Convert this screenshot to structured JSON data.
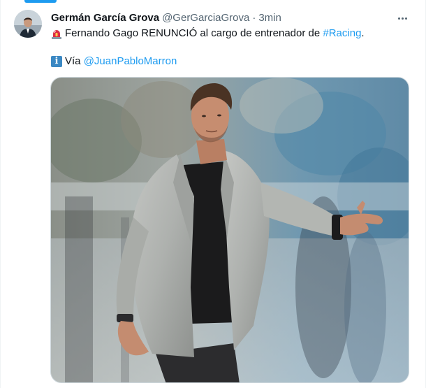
{
  "tweet": {
    "author_name": "Germán García Grova",
    "handle": "@GerGarciaGrova",
    "separator": "·",
    "time": "3min",
    "line1_text": "Fernando Gago RENUNCIÓ al cargo de entrenador de ",
    "hashtag": "#Racing",
    "line1_end": ".",
    "line2_prefix": "Vía ",
    "mention": "@JuanPabloMarron",
    "info_emoji": "i",
    "line1_emoji": "rotating-light-emoji",
    "more_icon": "more-horizontal-icon",
    "photo_subject": "man-in-gray-blazer-photo"
  },
  "colors": {
    "link": "#1d9bf0",
    "text": "#0f1419",
    "secondary": "#536471"
  }
}
